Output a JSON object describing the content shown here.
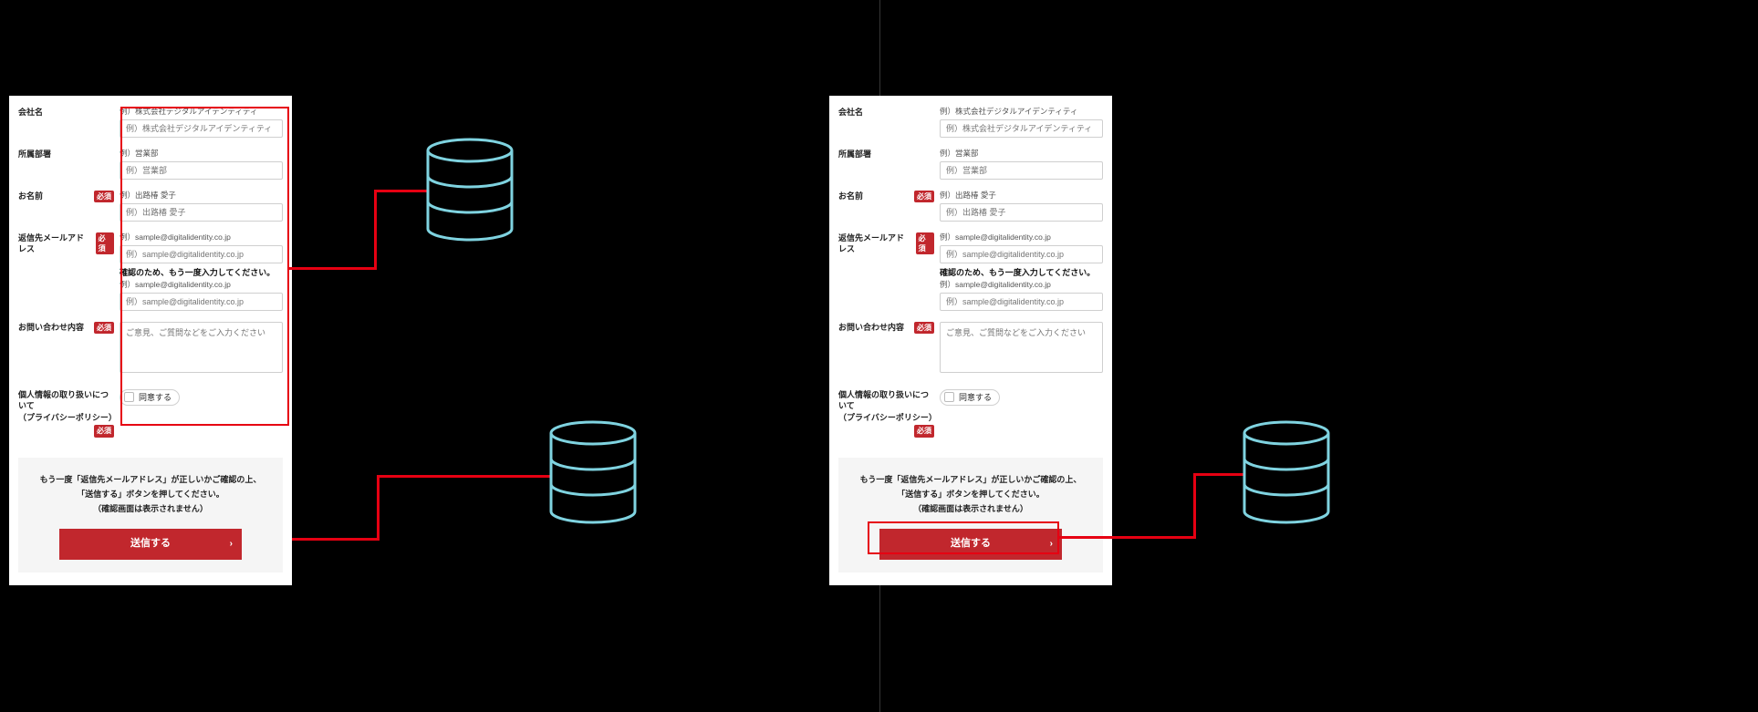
{
  "form": {
    "required_badge": "必須",
    "company": {
      "label": "会社名",
      "hint": "例）株式会社デジタルアイデンティティ",
      "placeholder": "例）株式会社デジタルアイデンティティ"
    },
    "department": {
      "label": "所属部署",
      "hint": "例）営業部",
      "placeholder": "例）営業部"
    },
    "name": {
      "label": "お名前",
      "hint": "例）出路椿 愛子",
      "placeholder": "例）出路椿 愛子"
    },
    "email": {
      "label": "返信先メールアドレス",
      "hint": "例）sample@digitalidentity.co.jp",
      "placeholder": "例）sample@digitalidentity.co.jp",
      "confirm_label": "確認のため、もう一度入力してください。",
      "confirm_hint": "例）sample@digitalidentity.co.jp",
      "confirm_placeholder": "例）sample@digitalidentity.co.jp"
    },
    "inquiry": {
      "label": "お問い合わせ内容",
      "placeholder": "ご意見、ご質問などをご入力ください"
    },
    "privacy": {
      "label_line1": "個人情報の取り扱いについて",
      "label_line2": "（プライバシーポリシー）",
      "consent_label": "同意する"
    },
    "notice": {
      "line1": "もう一度「返信先メールアドレス」が正しいかご確認の上、",
      "line2": "「送信する」ボタンを押してください。",
      "line3": "（確認画面は表示されません）"
    },
    "submit_label": "送信する"
  },
  "diagram": {
    "left_side": {
      "highlights": "form-fields-area",
      "flows_to": "database-top"
    },
    "right_side": {
      "highlights": "submit-button",
      "flows_to": "database-bottom"
    }
  }
}
